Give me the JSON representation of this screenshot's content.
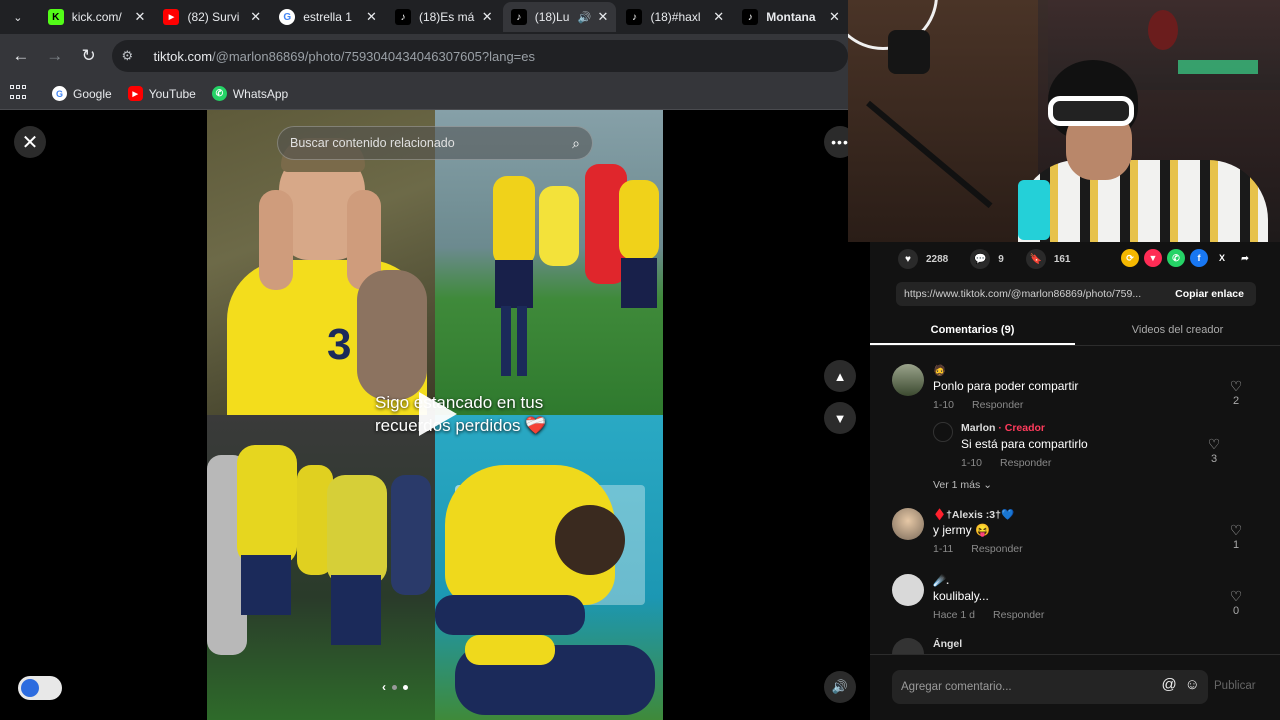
{
  "browser": {
    "tabs": [
      {
        "title": "kick.com/",
        "favicon": "kick-icon",
        "color": "#53fc18",
        "active": false
      },
      {
        "title": "(82) Survi",
        "favicon": "youtube-icon",
        "color": "#ff0000",
        "active": false
      },
      {
        "title": "estrella 1",
        "favicon": "google-icon",
        "color": "#ffffff",
        "active": false
      },
      {
        "title": "(18)Es má",
        "favicon": "tiktok-icon",
        "color": "#000000",
        "active": false
      },
      {
        "title": "(18)Lu",
        "favicon": "tiktok-icon",
        "color": "#000000",
        "active": true
      },
      {
        "title": "(18)#haxl",
        "favicon": "tiktok-icon",
        "color": "#000000",
        "active": false
      },
      {
        "title": "Montana",
        "favicon": "tiktok-icon",
        "color": "#000000",
        "active": false
      }
    ],
    "url_host": "tiktok.com",
    "url_path": "/@marlon86869/photo/7593040434046307605?lang=es",
    "bookmarks": [
      {
        "label": "Google",
        "icon": "google-icon"
      },
      {
        "label": "YouTube",
        "icon": "youtube-icon"
      },
      {
        "label": "WhatsApp",
        "icon": "whatsapp-icon"
      }
    ]
  },
  "viewer": {
    "search_placeholder": "Buscar contenido relacionado",
    "caption": "Sigo estancado en tus recuerdos perdidos ❤️‍🩹"
  },
  "post": {
    "likes": "2288",
    "comments": "9",
    "saves": "161",
    "share_link": "https://www.tiktok.com/@marlon86869/photo/759...",
    "copy_label": "Copiar enlace",
    "tabs": [
      "Comentarios (9)",
      "Videos del creador"
    ]
  },
  "comments": [
    {
      "user": "🧔",
      "text": "Ponlo para poder compartir",
      "date": "1-10",
      "reply": "Responder",
      "likes": "2"
    },
    {
      "user": "Marlon",
      "creator": "· Creador",
      "text": "Si está para compartirlo",
      "date": "1-10",
      "reply": "Responder",
      "likes": "3"
    },
    {
      "more": "Ver 1 más"
    },
    {
      "user": "♦️†Alexis :3†💙",
      "text": "y jermy 😝",
      "date": "1-11",
      "reply": "Responder",
      "likes": "1"
    },
    {
      "user": "☄️.",
      "text": "koulibaly...",
      "date": "Hace 1 d",
      "reply": "Responder",
      "likes": "0"
    },
    {
      "user": "Ángel"
    }
  ],
  "comment_input": {
    "placeholder": "Agregar comentario...",
    "publish": "Publicar"
  }
}
